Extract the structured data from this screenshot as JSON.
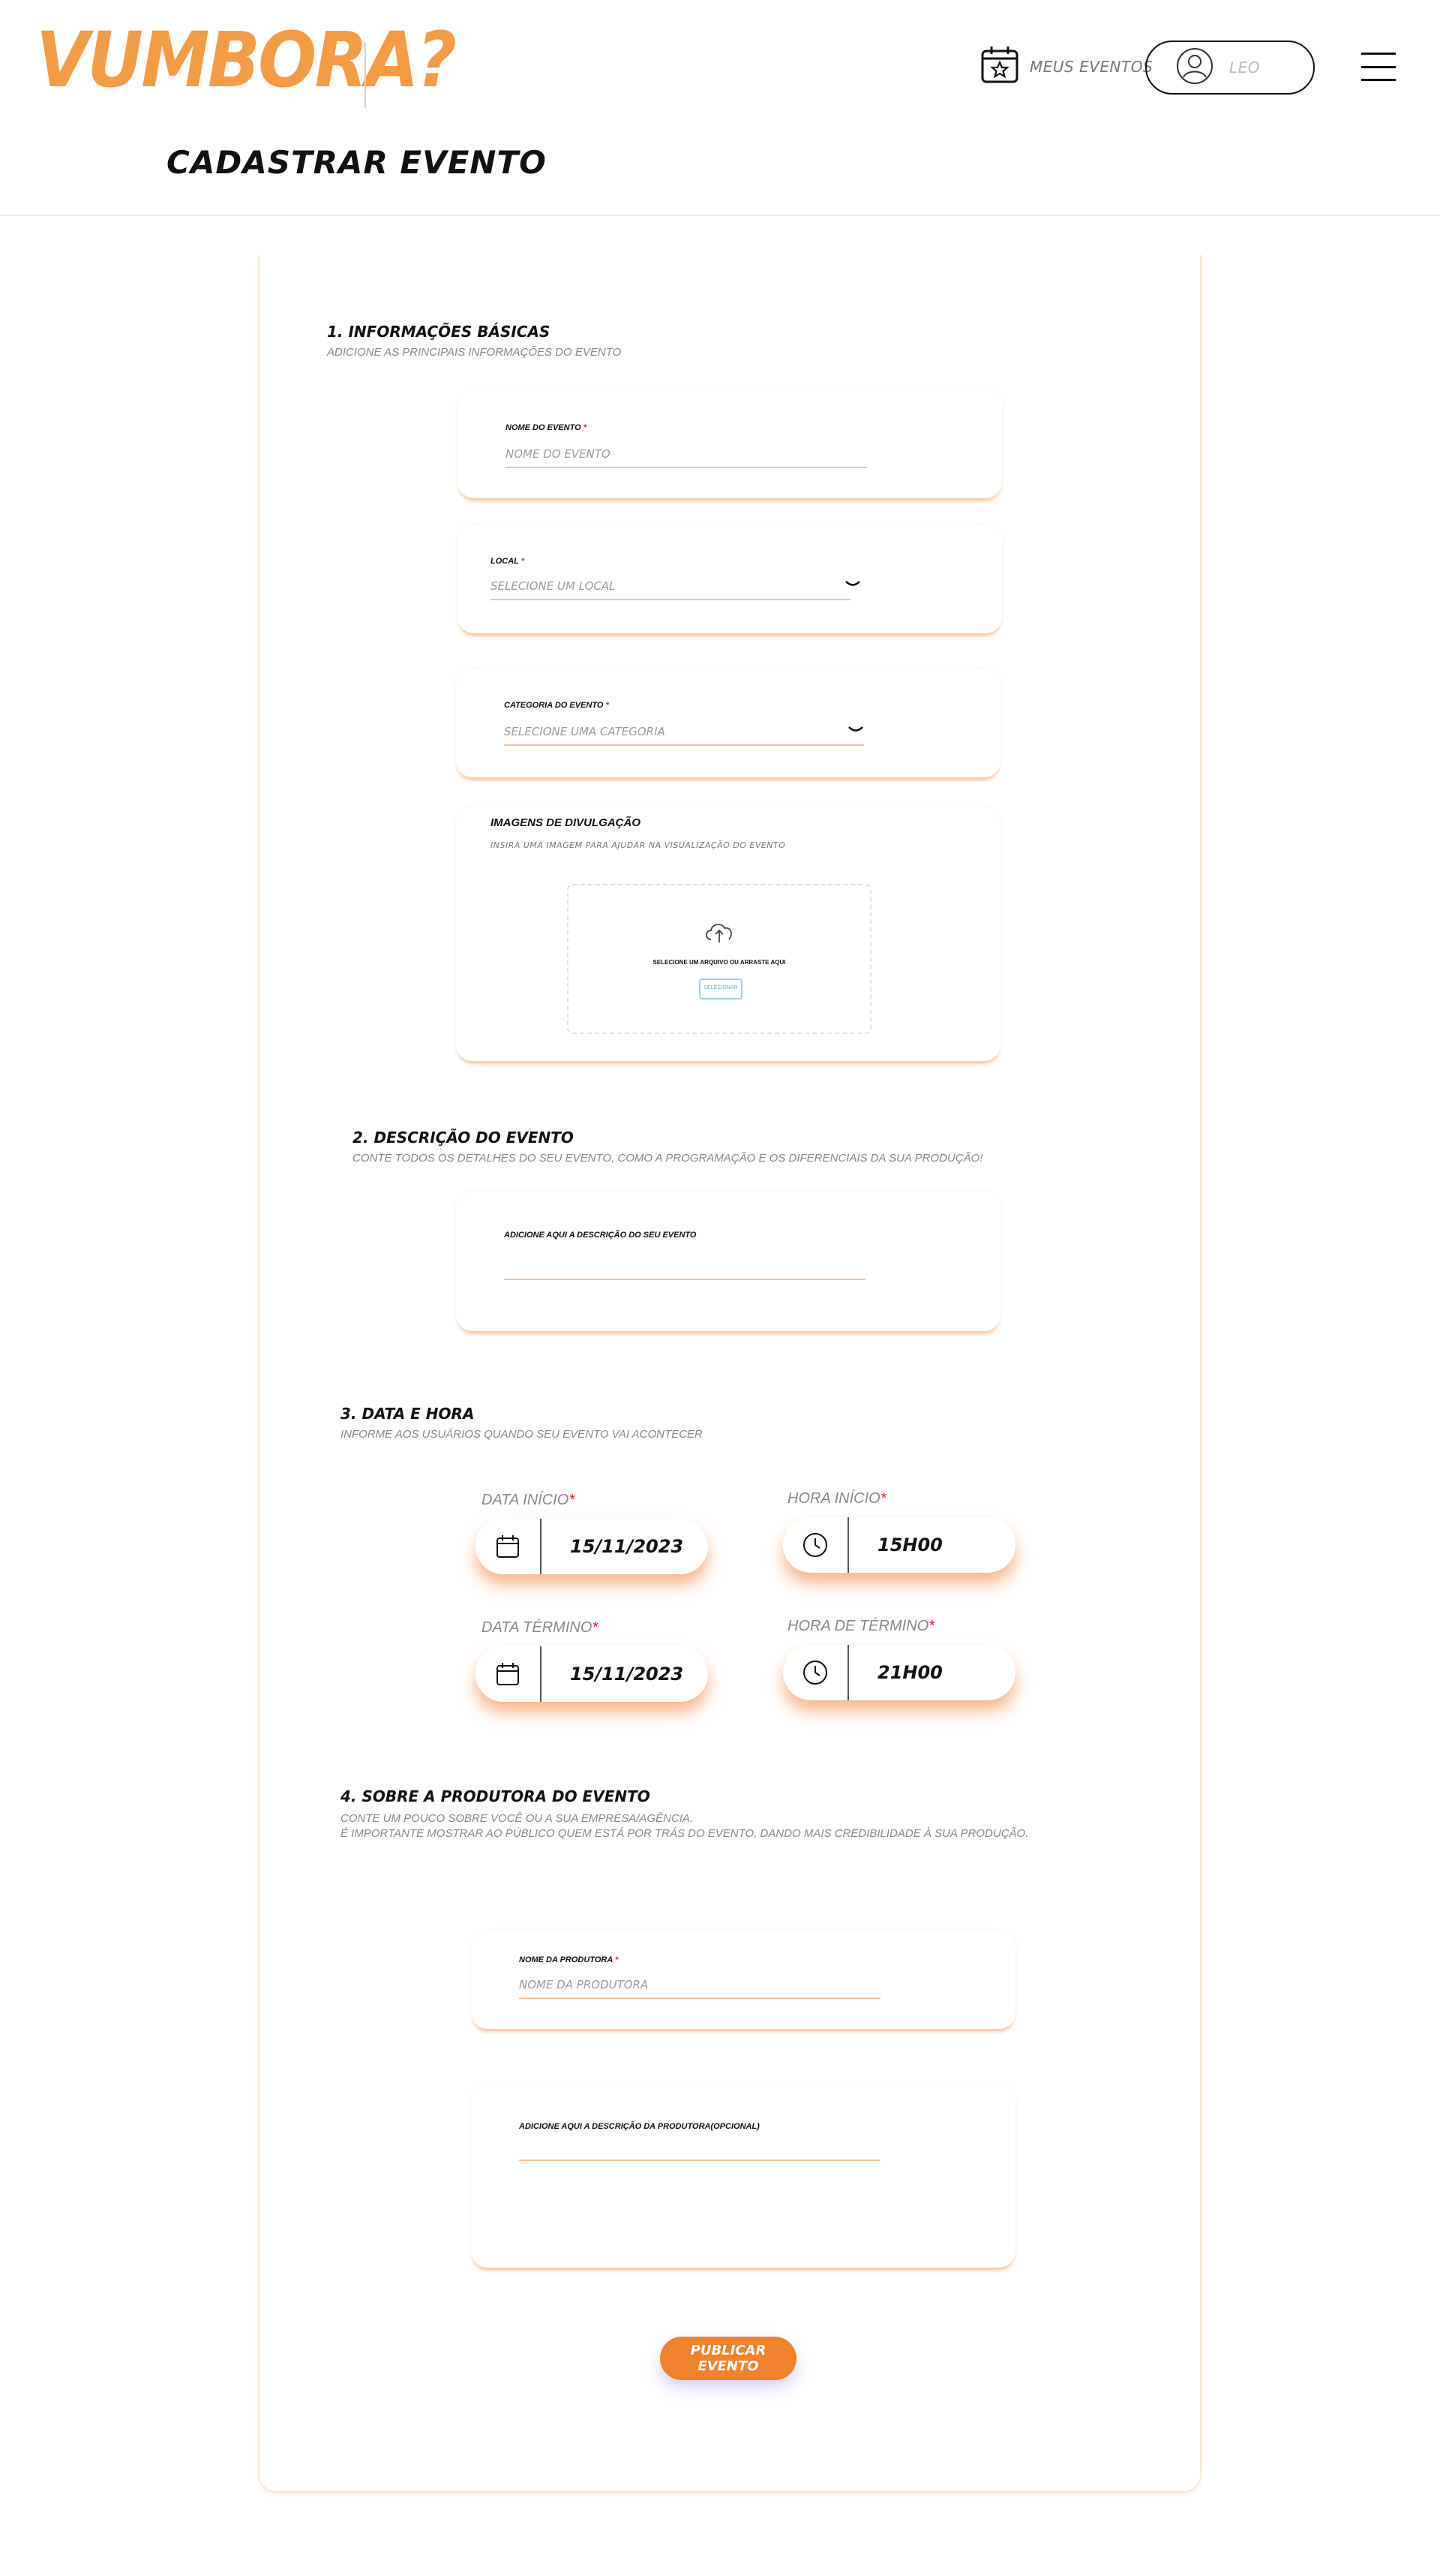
{
  "header": {
    "logo": "VUMBORA?",
    "nav_events_label": "MEUS EVENTOS",
    "user_name": "LEO",
    "page_title": "CADASTRAR EVENTO"
  },
  "section1": {
    "title": "1. INFORMAÇÕES BÁSICAS",
    "subtitle": "ADICIONE AS PRINCIPAIS INFORMAÇÕES DO EVENTO",
    "event_name": {
      "label": "NOME DO EVENTO",
      "required": "*",
      "placeholder": "NOME DO EVENTO"
    },
    "location": {
      "label": "LOCAL",
      "required": "*",
      "placeholder": "SELECIONE UM LOCAL"
    },
    "category": {
      "label": "CATEGORIA DO EVENTO",
      "required": "*",
      "placeholder": "SELECIONE UMA CATEGORIA"
    },
    "images": {
      "title": "IMAGENS DE DIVULGAÇÃO",
      "subtitle": "INSIRA UMA IMAGEM PARA AJUDAR NA VISUALIZAÇÃO DO EVENTO",
      "drop_text": "SELECIONE UM ARQUIVO OU ARRASTE AQUI",
      "button": "SELECIONAR"
    }
  },
  "section2": {
    "title": "2. DESCRIÇÃO DO EVENTO",
    "subtitle": "CONTE TODOS OS DETALHES DO SEU EVENTO, COMO A PROGRAMAÇÃO E OS DIFERENCIAIS DA SUA PRODUÇÃO!",
    "description_label": "ADICIONE AQUI A DESCRIÇÃO DO SEU EVENTO"
  },
  "section3": {
    "title": "3. DATA E HORA",
    "subtitle": "INFORME AOS USUÁRIOS QUANDO SEU EVENTO VAI ACONTECER",
    "start_date": {
      "label": "DATA INÍCIO",
      "required": "*",
      "value": "15/11/2023"
    },
    "start_time": {
      "label": "HORA INÍCIO",
      "required": "*",
      "value": "15H00"
    },
    "end_date": {
      "label": "DATA TÉRMINO",
      "required": "*",
      "value": "15/11/2023"
    },
    "end_time": {
      "label": "HORA DE TÉRMINO",
      "required": "*",
      "value": "21H00"
    }
  },
  "section4": {
    "title": "4. SOBRE A PRODUTORA DO EVENTO",
    "subtitle_line1": "CONTE UM POUCO SOBRE VOCÊ OU A SUA EMPRESA/AGÊNCIA.",
    "subtitle_line2": "É IMPORTANTE MOSTRAR AO PÚBLICO QUEM ESTÁ POR TRÁS DO EVENTO, DANDO MAIS CREDIBILIDADE À SUA PRODUÇÃO.",
    "producer_name": {
      "label": "NOME DA PRODUTORA",
      "required": "*",
      "placeholder": "NOME DA PRODUTORA"
    },
    "producer_description_label": "ADICIONE AQUI A DESCRIÇÃO DA PRODUTORA(OPCIONAL)"
  },
  "publish_button": "PUBLICAR EVENTO",
  "colors": {
    "brand_orange": "#f49b46",
    "button_orange": "#f0812d",
    "required_red": "#e02020"
  },
  "icons": [
    "calendar-star-icon",
    "user-avatar-icon",
    "hamburger-menu-icon",
    "chevron-down-icon",
    "cloud-upload-icon",
    "calendar-icon",
    "clock-icon"
  ]
}
